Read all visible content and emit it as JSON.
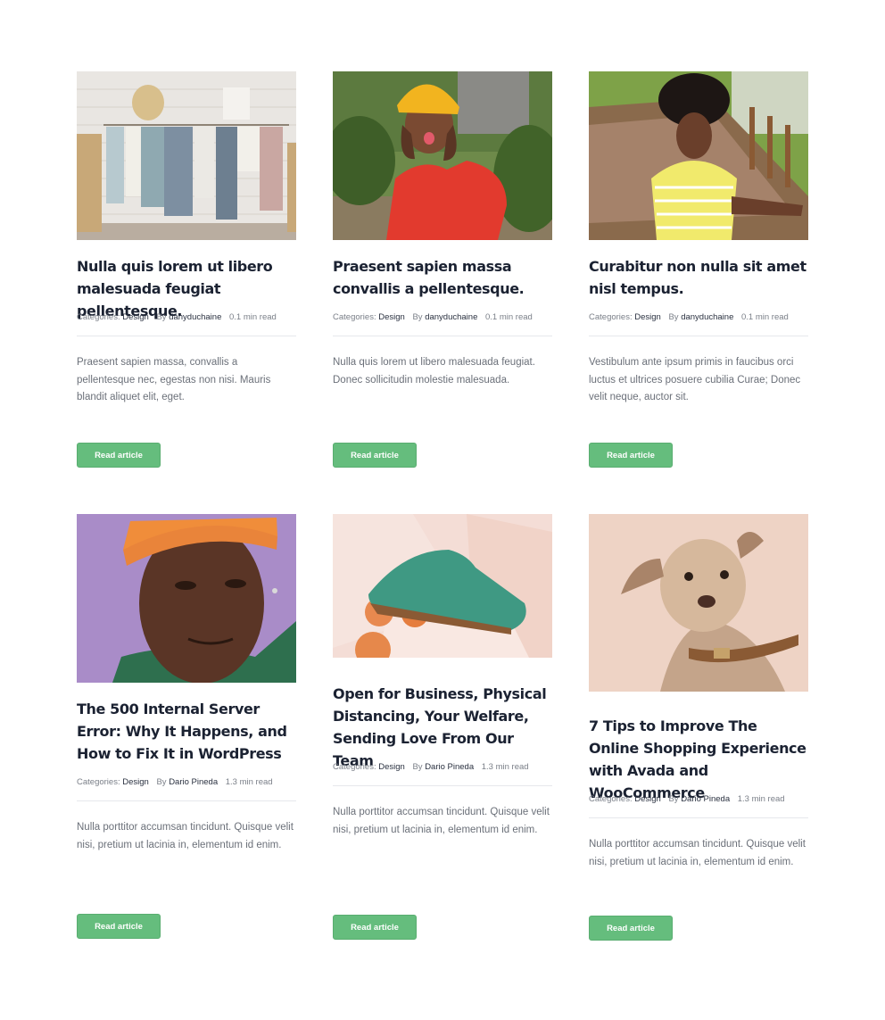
{
  "labels": {
    "categories": "Categories:",
    "by": "By",
    "button": "Read article"
  },
  "cards": [
    {
      "title": "Nulla quis lorem ut libero malesuada feugiat pellentesque.",
      "category": "Design",
      "author": "danyduchaine",
      "read_time": "0.1 min read",
      "excerpt": "Praesent sapien massa, convallis a pellentesque nec, egestas non nisi. Mauris blandit aliquet elit, eget.",
      "image": "towels-on-hangers-photo"
    },
    {
      "title": "Praesent sapien massa convallis a pellentesque.",
      "category": "Design",
      "author": "danyduchaine",
      "read_time": "0.1 min read",
      "excerpt": "Nulla quis lorem ut libero malesuada feugiat. Donec sollicitudin molestie malesuada.",
      "image": "woman-yellow-beanie-photo"
    },
    {
      "title": "Curabitur non nulla sit amet nisl tempus.",
      "category": "Design",
      "author": "danyduchaine",
      "read_time": "0.1 min read",
      "excerpt": "Vestibulum ante ipsum primis in faucibus orci luctus et ultrices posuere cubilia Curae; Donec velit neque, auctor sit.",
      "image": "woman-striped-shirt-photo"
    },
    {
      "title": "The 500 Internal Server Error: Why It Happens, and How to Fix It in WordPress",
      "category": "Design",
      "author": "Dario Pineda",
      "read_time": "1.3 min read",
      "excerpt": "Nulla porttitor accumsan tincidunt. Quisque velit nisi, pretium ut lacinia in, elementum id enim.",
      "image": "man-orange-bandana-photo"
    },
    {
      "title": "Open for Business, Physical Distancing, Your Welfare, Sending Love From Our Team",
      "category": "Design",
      "author": "Dario Pineda",
      "read_time": "1.3 min read",
      "excerpt": "Nulla porttitor accumsan tincidunt. Quisque velit nisi, pretium ut lacinia in, elementum id enim.",
      "image": "green-shoe-peaches-photo"
    },
    {
      "title": "7 Tips to Improve The Online Shopping Experience with Avada and WooCommerce",
      "category": "Design",
      "author": "Dario Pineda",
      "read_time": "1.3 min read",
      "excerpt": "Nulla porttitor accumsan tincidunt. Quisque velit nisi, pretium ut lacinia in, elementum id enim.",
      "image": "dog-with-collar-photo"
    }
  ],
  "colors": {
    "button_bg": "#65bd7d",
    "title": "#1b2232",
    "text": "#6b7079"
  }
}
